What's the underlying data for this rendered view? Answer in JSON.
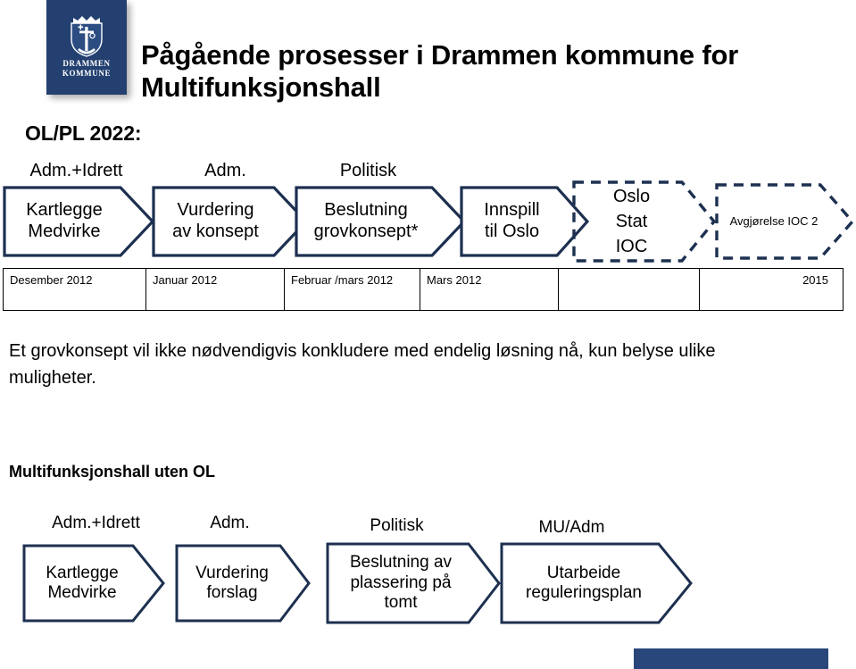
{
  "logo": {
    "name": "drammen-kommune-logo",
    "line1": "DRAMMEN",
    "line2": "KOMMUNE",
    "color": "#234070"
  },
  "title": "Pågående prosesser i Drammen kommune for Multifunksjonshall",
  "sections": {
    "ol_heading": "OL/PL 2022:",
    "uten_ol_heading": "Multifunksjonshall uten OL"
  },
  "body_text": "Et grovkonsept vil ikke nødvendigvis konkludere med endelig løsning nå, kun belyse ulike muligheter.",
  "process_ol": {
    "steps": [
      {
        "caption": "Adm.+Idrett",
        "label": "Kartlegge\nMedvirke",
        "style": "solid"
      },
      {
        "caption": "Adm.",
        "label": "Vurdering\nav konsept",
        "style": "solid"
      },
      {
        "caption": "Politisk",
        "label": "Beslutning\ngrovkonsept*",
        "style": "solid"
      },
      {
        "caption": "",
        "label": "Innspill\ntil Oslo",
        "style": "solid"
      },
      {
        "caption": "",
        "label": "Oslo\nStat\nIOC",
        "style": "dashed"
      },
      {
        "caption": "",
        "label": "Avgjørelse  IOC 2",
        "style": "dashed"
      }
    ]
  },
  "timeline": {
    "cells": [
      "Desember 2012",
      "Januar 2012",
      "Februar /mars 2012",
      "Mars 2012",
      "",
      "2015"
    ]
  },
  "process_uten_ol": {
    "steps": [
      {
        "caption": "Adm.+Idrett",
        "label": "Kartlegge\nMedvirke"
      },
      {
        "caption": "Adm.",
        "label": "Vurdering\nforslag"
      },
      {
        "caption": "Politisk",
        "label": "Beslutning av\nplassering på\ntomt"
      },
      {
        "caption": "MU/Adm",
        "label": "Utarbeide\nreguleringsplan"
      }
    ]
  },
  "colors": {
    "chevron_stroke": "#1d3050",
    "brand_blue": "#234070",
    "footer_bar": "#29477a"
  }
}
